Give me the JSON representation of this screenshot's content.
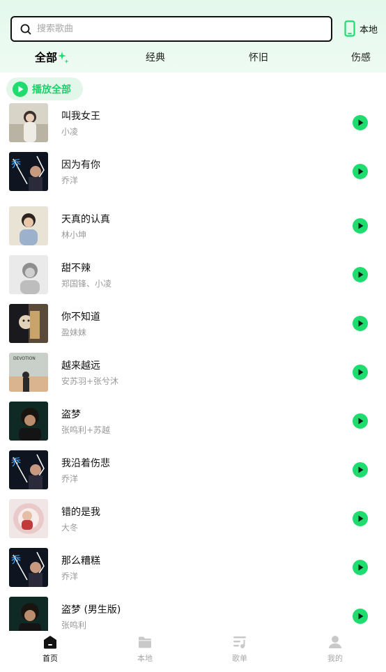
{
  "search": {
    "placeholder": "搜索歌曲"
  },
  "local_button": {
    "label": "本地",
    "icon": "phone-icon"
  },
  "tabs": [
    {
      "label": "全部",
      "active": true
    },
    {
      "label": "经典",
      "active": false
    },
    {
      "label": "怀旧",
      "active": false
    },
    {
      "label": "伤感",
      "active": false
    }
  ],
  "play_all": {
    "label": "播放全部",
    "icon": "play-circle-icon"
  },
  "songs": [
    {
      "title": "叫我女王",
      "artist": "小凌"
    },
    {
      "title": "因为有你",
      "artist": "乔洋"
    },
    {
      "title": "天真的认真",
      "artist": "林小坤"
    },
    {
      "title": "甜不辣",
      "artist": "郑国锋、小凌"
    },
    {
      "title": "你不知道",
      "artist": "盈妹妹"
    },
    {
      "title": "越来越远",
      "artist": "安苏羽+张兮沐"
    },
    {
      "title": "盗梦",
      "artist": "张鸣利+苏越"
    },
    {
      "title": "我沿着伤悲",
      "artist": "乔洋"
    },
    {
      "title": "错的是我",
      "artist": "大冬"
    },
    {
      "title": "那么糟糕",
      "artist": "乔洋"
    },
    {
      "title": "盗梦 (男生版)",
      "artist": "张鸣利"
    }
  ],
  "bottom_nav": [
    {
      "label": "首页",
      "icon": "home-icon",
      "active": true
    },
    {
      "label": "本地",
      "icon": "folder-icon",
      "active": false
    },
    {
      "label": "歌单",
      "icon": "playlist-icon",
      "active": false
    },
    {
      "label": "我的",
      "icon": "user-icon",
      "active": false
    }
  ],
  "colors": {
    "accent": "#1fdc6e",
    "header_bg": "#e4f8ec",
    "muted_text": "#9a9a9a"
  }
}
